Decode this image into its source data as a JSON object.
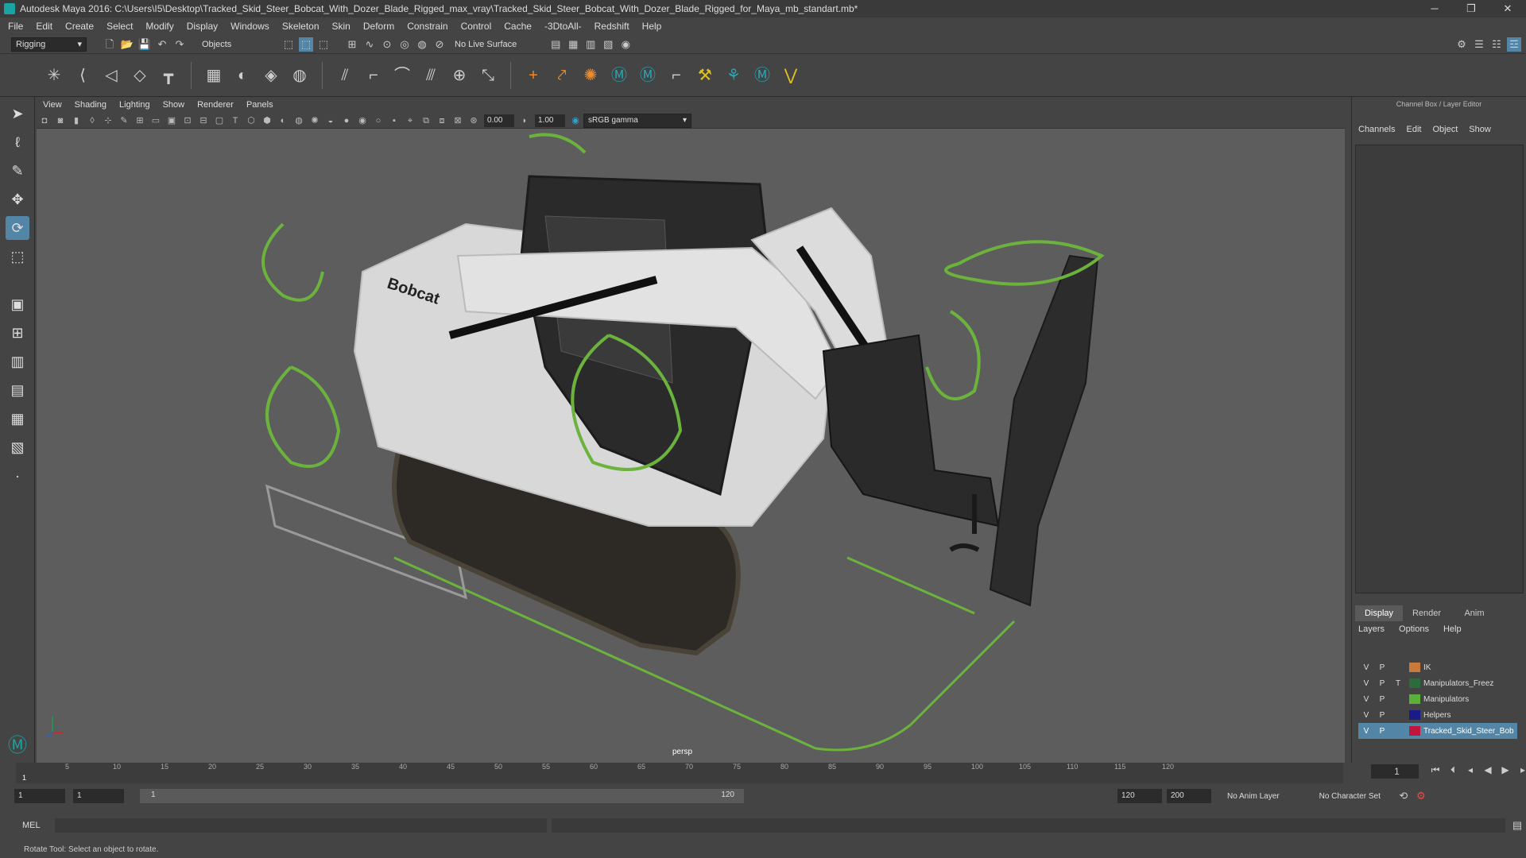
{
  "window": {
    "title": "Autodesk Maya 2016: C:\\Users\\I5\\Desktop\\Tracked_Skid_Steer_Bobcat_With_Dozer_Blade_Rigged_max_vray\\Tracked_Skid_Steer_Bobcat_With_Dozer_Blade_Rigged_for_Maya_mb_standart.mb*"
  },
  "menu": [
    "File",
    "Edit",
    "Create",
    "Select",
    "Modify",
    "Display",
    "Windows",
    "Skeleton",
    "Skin",
    "Deform",
    "Constrain",
    "Control",
    "Cache",
    "-3DtoAll-",
    "Redshift",
    "Help"
  ],
  "status": {
    "mode": "Rigging",
    "selection": "Objects",
    "live_surface": "No Live Surface"
  },
  "viewport_menu": [
    "View",
    "Shading",
    "Lighting",
    "Show",
    "Renderer",
    "Panels"
  ],
  "viewport_toolbar": {
    "exposure": "0.00",
    "gamma": "1.00",
    "colorspace": "sRGB gamma"
  },
  "viewport": {
    "camera": "persp",
    "brand": "Bobcat"
  },
  "right_panel": {
    "title": "Channel Box / Layer Editor",
    "menu": [
      "Channels",
      "Edit",
      "Object",
      "Show"
    ],
    "tabs": [
      "Display",
      "Render",
      "Anim"
    ],
    "layer_menu": [
      "Layers",
      "Options",
      "Help"
    ],
    "layers": [
      {
        "v": "V",
        "p": "P",
        "t": "",
        "name": "IK",
        "color": "#c87a3a"
      },
      {
        "v": "V",
        "p": "P",
        "t": "T",
        "name": "Manipulators_Freez",
        "color": "#2e6b3c"
      },
      {
        "v": "V",
        "p": "P",
        "t": "",
        "name": "Manipulators",
        "color": "#5bb03a"
      },
      {
        "v": "V",
        "p": "P",
        "t": "",
        "name": "Helpers",
        "color": "#1a1a8a"
      },
      {
        "v": "V",
        "p": "P",
        "t": "",
        "name": "Tracked_Skid_Steer_Bob",
        "color": "#c0163c"
      }
    ]
  },
  "timeline": {
    "ticks": [
      "5",
      "10",
      "15",
      "20",
      "25",
      "30",
      "35",
      "40",
      "45",
      "50",
      "55",
      "60",
      "65",
      "70",
      "75",
      "80",
      "85",
      "90",
      "95",
      "100",
      "105",
      "110",
      "115",
      "120"
    ],
    "start_mark": "1",
    "current": "1"
  },
  "range": {
    "start": "1",
    "start2": "1",
    "slider_start": "1",
    "slider_end": "120",
    "end": "120",
    "end2": "200",
    "anim_layer": "No Anim Layer",
    "char_set": "No Character Set"
  },
  "cmd": {
    "label": "MEL"
  },
  "help": "Rotate Tool: Select an object to rotate."
}
